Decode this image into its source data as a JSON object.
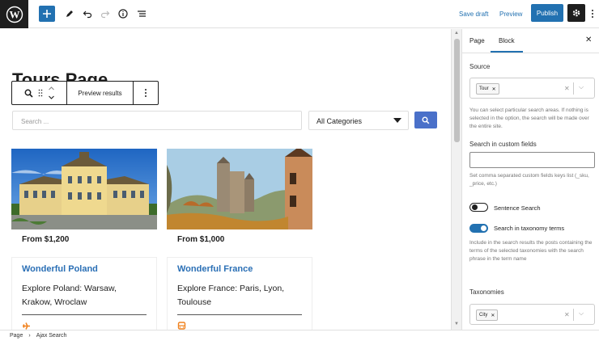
{
  "topbar": {
    "save_draft": "Save draft",
    "preview": "Preview",
    "publish": "Publish"
  },
  "editor": {
    "page_title": "Tours Page",
    "block_toolbar": {
      "preview_results": "Preview results"
    },
    "search": {
      "placeholder": "Search ..."
    },
    "category_select": {
      "selected": "All Categories"
    },
    "cards": [
      {
        "price": "From $1,200",
        "title": "Wonderful Poland",
        "description": "Explore Poland: Warsaw, Krakow, Wroclaw",
        "icon": "plane-icon"
      },
      {
        "price": "From $1,000",
        "title": "Wonderful France",
        "description": "Explore France: Paris, Lyon, Toulouse",
        "icon": "bus-icon"
      }
    ]
  },
  "breadcrumb": [
    "Page",
    "Ajax Search"
  ],
  "sidebar": {
    "tabs": {
      "page": "Page",
      "block": "Block"
    },
    "source": {
      "label": "Source",
      "chip": "Tour",
      "help": "You can select particular search areas. If nothing is selected in the option, the search will be made over the entire site."
    },
    "custom_fields": {
      "label": "Search in custom fields",
      "value": "",
      "help": "Set comma separated custom fields keys list (_sku, _price, etc.)"
    },
    "sentence_search": {
      "label": "Sentence Search",
      "on": false
    },
    "taxonomy_search": {
      "label": "Search in taxonomy terms",
      "on": true,
      "help": "Include in the search results the posts containing the terms of the selected taxonomies with the search phrase in the term name"
    },
    "taxonomies": {
      "label": "Taxonomies",
      "chip": "City"
    }
  },
  "colors": {
    "accent": "#2271b1",
    "search_button": "#4a70c9",
    "card_title": "#2a6fb5",
    "tag_icon": "#f0821e"
  }
}
